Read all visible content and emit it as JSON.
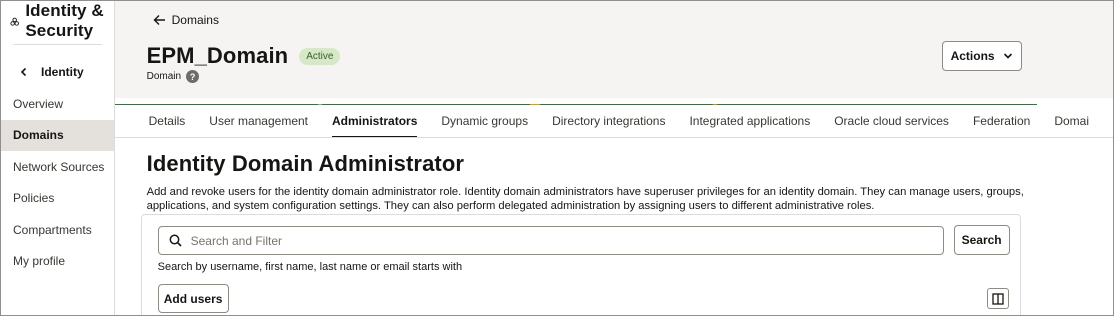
{
  "sidebar": {
    "title": "Identity & Security",
    "back_label": "Identity",
    "items": [
      {
        "label": "Overview",
        "active": false
      },
      {
        "label": "Domains",
        "active": true
      },
      {
        "label": "Network Sources",
        "active": false
      },
      {
        "label": "Policies",
        "active": false
      },
      {
        "label": "Compartments",
        "active": false
      },
      {
        "label": "My profile",
        "active": false
      }
    ]
  },
  "header": {
    "breadcrumb": "Domains",
    "title": "EPM_Domain",
    "status": "Active",
    "subtitle": "Domain",
    "help_glyph": "?",
    "actions_label": "Actions"
  },
  "tabs": [
    {
      "label": "Details",
      "active": false
    },
    {
      "label": "User management",
      "active": false
    },
    {
      "label": "Administrators",
      "active": true
    },
    {
      "label": "Dynamic groups",
      "active": false
    },
    {
      "label": "Directory integrations",
      "active": false
    },
    {
      "label": "Integrated applications",
      "active": false
    },
    {
      "label": "Oracle cloud services",
      "active": false
    },
    {
      "label": "Federation",
      "active": false
    },
    {
      "label": "Domai",
      "active": false
    }
  ],
  "content": {
    "heading": "Identity Domain Administrator",
    "description": "Add and revoke users for the identity domain administrator role. Identity domain administrators have superuser privileges for an identity domain. They can manage users, groups, applications, and system configuration settings. They can also perform delegated administration by assigning users to different administrative roles.",
    "search_placeholder": "Search and Filter",
    "search_button": "Search",
    "search_hint": "Search by username, first name, last name or email starts with",
    "add_users_button": "Add users"
  },
  "colors": {
    "accent_dark": "#161513",
    "badge_bg": "#d6e8c7",
    "badge_text": "#3c5e26",
    "active_nav_bg": "#e4e1dd",
    "header_bg": "#f5f4f2"
  }
}
